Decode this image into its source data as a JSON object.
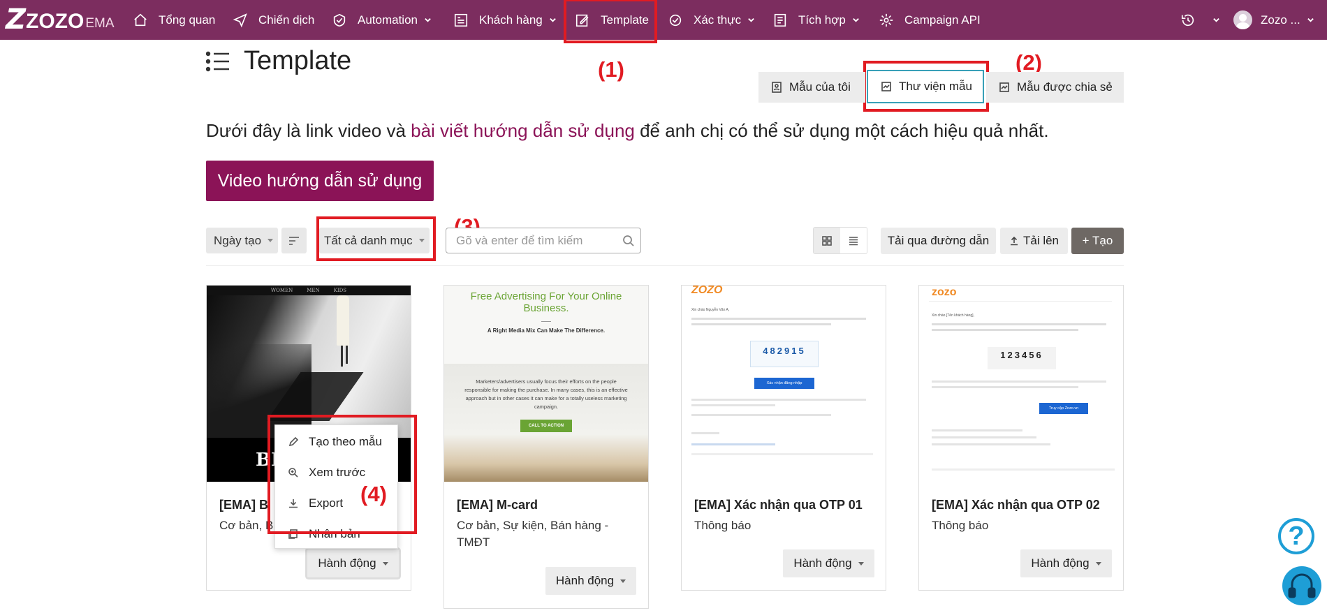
{
  "brand": {
    "logo_z": "Z",
    "logo_text": "ZOZO",
    "logo_suffix": "EMA"
  },
  "nav": {
    "items": [
      {
        "label": "Tổng quan",
        "icon": "home-icon",
        "dropdown": false
      },
      {
        "label": "Chiến dịch",
        "icon": "send-icon",
        "dropdown": false
      },
      {
        "label": "Automation",
        "icon": "automation-icon",
        "dropdown": true
      },
      {
        "label": "Khách hàng",
        "icon": "customers-icon",
        "dropdown": true
      },
      {
        "label": "Template",
        "icon": "edit-icon",
        "dropdown": false
      },
      {
        "label": "Xác thực",
        "icon": "verify-icon",
        "dropdown": true
      },
      {
        "label": "Tích hợp",
        "icon": "integration-icon",
        "dropdown": true
      },
      {
        "label": "Campaign API",
        "icon": "api-icon",
        "dropdown": false
      }
    ],
    "user_name": "Zozo ...",
    "history_icon": "history-icon"
  },
  "annotations": [
    "(1)",
    "(2)",
    "(3)",
    "(4)"
  ],
  "page": {
    "title": "Template"
  },
  "tabs": [
    {
      "label": "Mẫu của tôi",
      "active": false
    },
    {
      "label": "Thư viện mẫu",
      "active": true
    },
    {
      "label": "Mẫu được chia sẻ",
      "active": false
    }
  ],
  "intro": {
    "before": "Dưới đây là link video và ",
    "link": "bài viết hướng dẫn sử dụng",
    "after": " để anh chị có thể sử dụng một cách hiệu quả nhất."
  },
  "video_button": "Video hướng dẫn sử dụng",
  "toolbar": {
    "sort_label": "Ngày tạo",
    "category_label": "Tất cả danh mục",
    "search_placeholder": "Gõ và enter để tìm kiếm",
    "load_url_label": "Tải qua đường dẫn",
    "upload_label": "Tải lên",
    "create_label": "+ Tạo"
  },
  "cards": [
    {
      "title": "[EMA] B",
      "tags": "Cơ bản, B",
      "action": "Hành động"
    },
    {
      "title": "[EMA] M-card",
      "tags_line1": "Cơ bản, Sự kiện, Bán hàng -",
      "tags_line2": "TMĐT",
      "action": "Hành động"
    },
    {
      "title": "[EMA] Xác nhận qua OTP 01",
      "tags": "Thông báo",
      "action": "Hành động"
    },
    {
      "title": "[EMA] Xác nhận qua OTP 02",
      "tags": "Thông báo",
      "action": "Hành động"
    }
  ],
  "thumb_text": {
    "t1_nav": [
      "WOMEN",
      "MEN",
      "KIDS"
    ],
    "t1_big": "BL",
    "t2_headline1": "Free Advertising For Your Online",
    "t2_headline2": "Business.",
    "t2_sub": "A Right Media Mix Can Make The Difference.",
    "t2_body1": "Marketers/advertisers usually focus their efforts on the people",
    "t2_body2": "responsible for making the purchase. In many cases, this is an effective",
    "t2_body3": "approach but in other cases it can make for a totally useless marketing",
    "t2_body4": "campaign.",
    "t2_cta": "CALL TO ACTION",
    "t3_logo": "ZOZO",
    "t3_greet": "Xin chào Nguyễn Văn A,",
    "t3_code": "482915",
    "t3_button": "Xác nhận đăng nhập",
    "t4_logo": "zozo",
    "t4_greet": "Xin chào [Tên khách hàng],",
    "t4_code": "123456",
    "t4_button": "Truy cập Zozo.vn"
  },
  "action_menu": [
    {
      "label": "Tạo theo mẫu",
      "icon": "pencil-icon"
    },
    {
      "label": "Xem trước",
      "icon": "zoom-icon"
    },
    {
      "label": "Export",
      "icon": "download-icon"
    },
    {
      "label": "Nhân bản",
      "icon": "copy-icon"
    }
  ],
  "help": {
    "label": "?"
  },
  "colors": {
    "brand": "#7c2d5f",
    "accent": "#8b1357",
    "annotation": "#e11b22",
    "help": "#1e9ed6"
  }
}
